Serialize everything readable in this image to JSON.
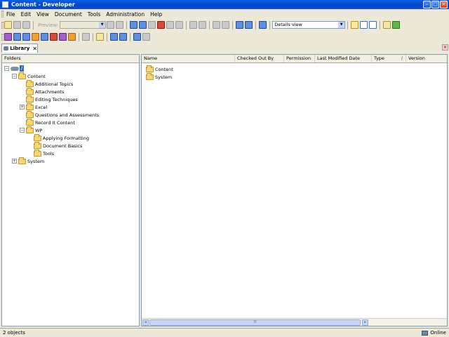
{
  "window": {
    "title": "Content - Developer",
    "controls": {
      "minimize": "–",
      "maximize": "□",
      "close": "×"
    }
  },
  "menu": [
    "File",
    "Edit",
    "View",
    "Document",
    "Tools",
    "Administration",
    "Help"
  ],
  "toolbar": {
    "preview_label": "Preview:",
    "preview_value": "",
    "view_select_value": "Details view"
  },
  "tabs": [
    {
      "label": "Library",
      "close": "✕"
    }
  ],
  "folders_pane": {
    "header": "Folders",
    "tree": [
      {
        "label": "/",
        "level": 0,
        "expander": "−",
        "icon": "network-icon",
        "selected": true
      },
      {
        "label": "Content",
        "level": 1,
        "expander": "−"
      },
      {
        "label": "Additional Topics",
        "level": 2,
        "expander": ""
      },
      {
        "label": "Attachments",
        "level": 2,
        "expander": ""
      },
      {
        "label": "Editing Techniques",
        "level": 2,
        "expander": ""
      },
      {
        "label": "Excel",
        "level": 2,
        "expander": "+"
      },
      {
        "label": "Questions and Assessments",
        "level": 2,
        "expander": ""
      },
      {
        "label": "Record It Content",
        "level": 2,
        "expander": ""
      },
      {
        "label": "WP",
        "level": 2,
        "expander": "−"
      },
      {
        "label": "Applying Formatting",
        "level": 3,
        "expander": ""
      },
      {
        "label": "Document Basics",
        "level": 3,
        "expander": ""
      },
      {
        "label": "Tools",
        "level": 3,
        "expander": ""
      },
      {
        "label": "System",
        "level": 1,
        "expander": "+"
      }
    ]
  },
  "list_pane": {
    "columns": [
      "Name",
      "Checked Out By",
      "Permission",
      "Last Modified Date",
      "Type",
      "Version"
    ],
    "sort_indicator": "/",
    "rows": [
      {
        "name": "Content"
      },
      {
        "name": "System"
      }
    ],
    "scrollbar": {
      "left": "◂",
      "right": "▸",
      "grip": "III"
    }
  },
  "status": {
    "count": "2 objects",
    "connection": "Online"
  }
}
